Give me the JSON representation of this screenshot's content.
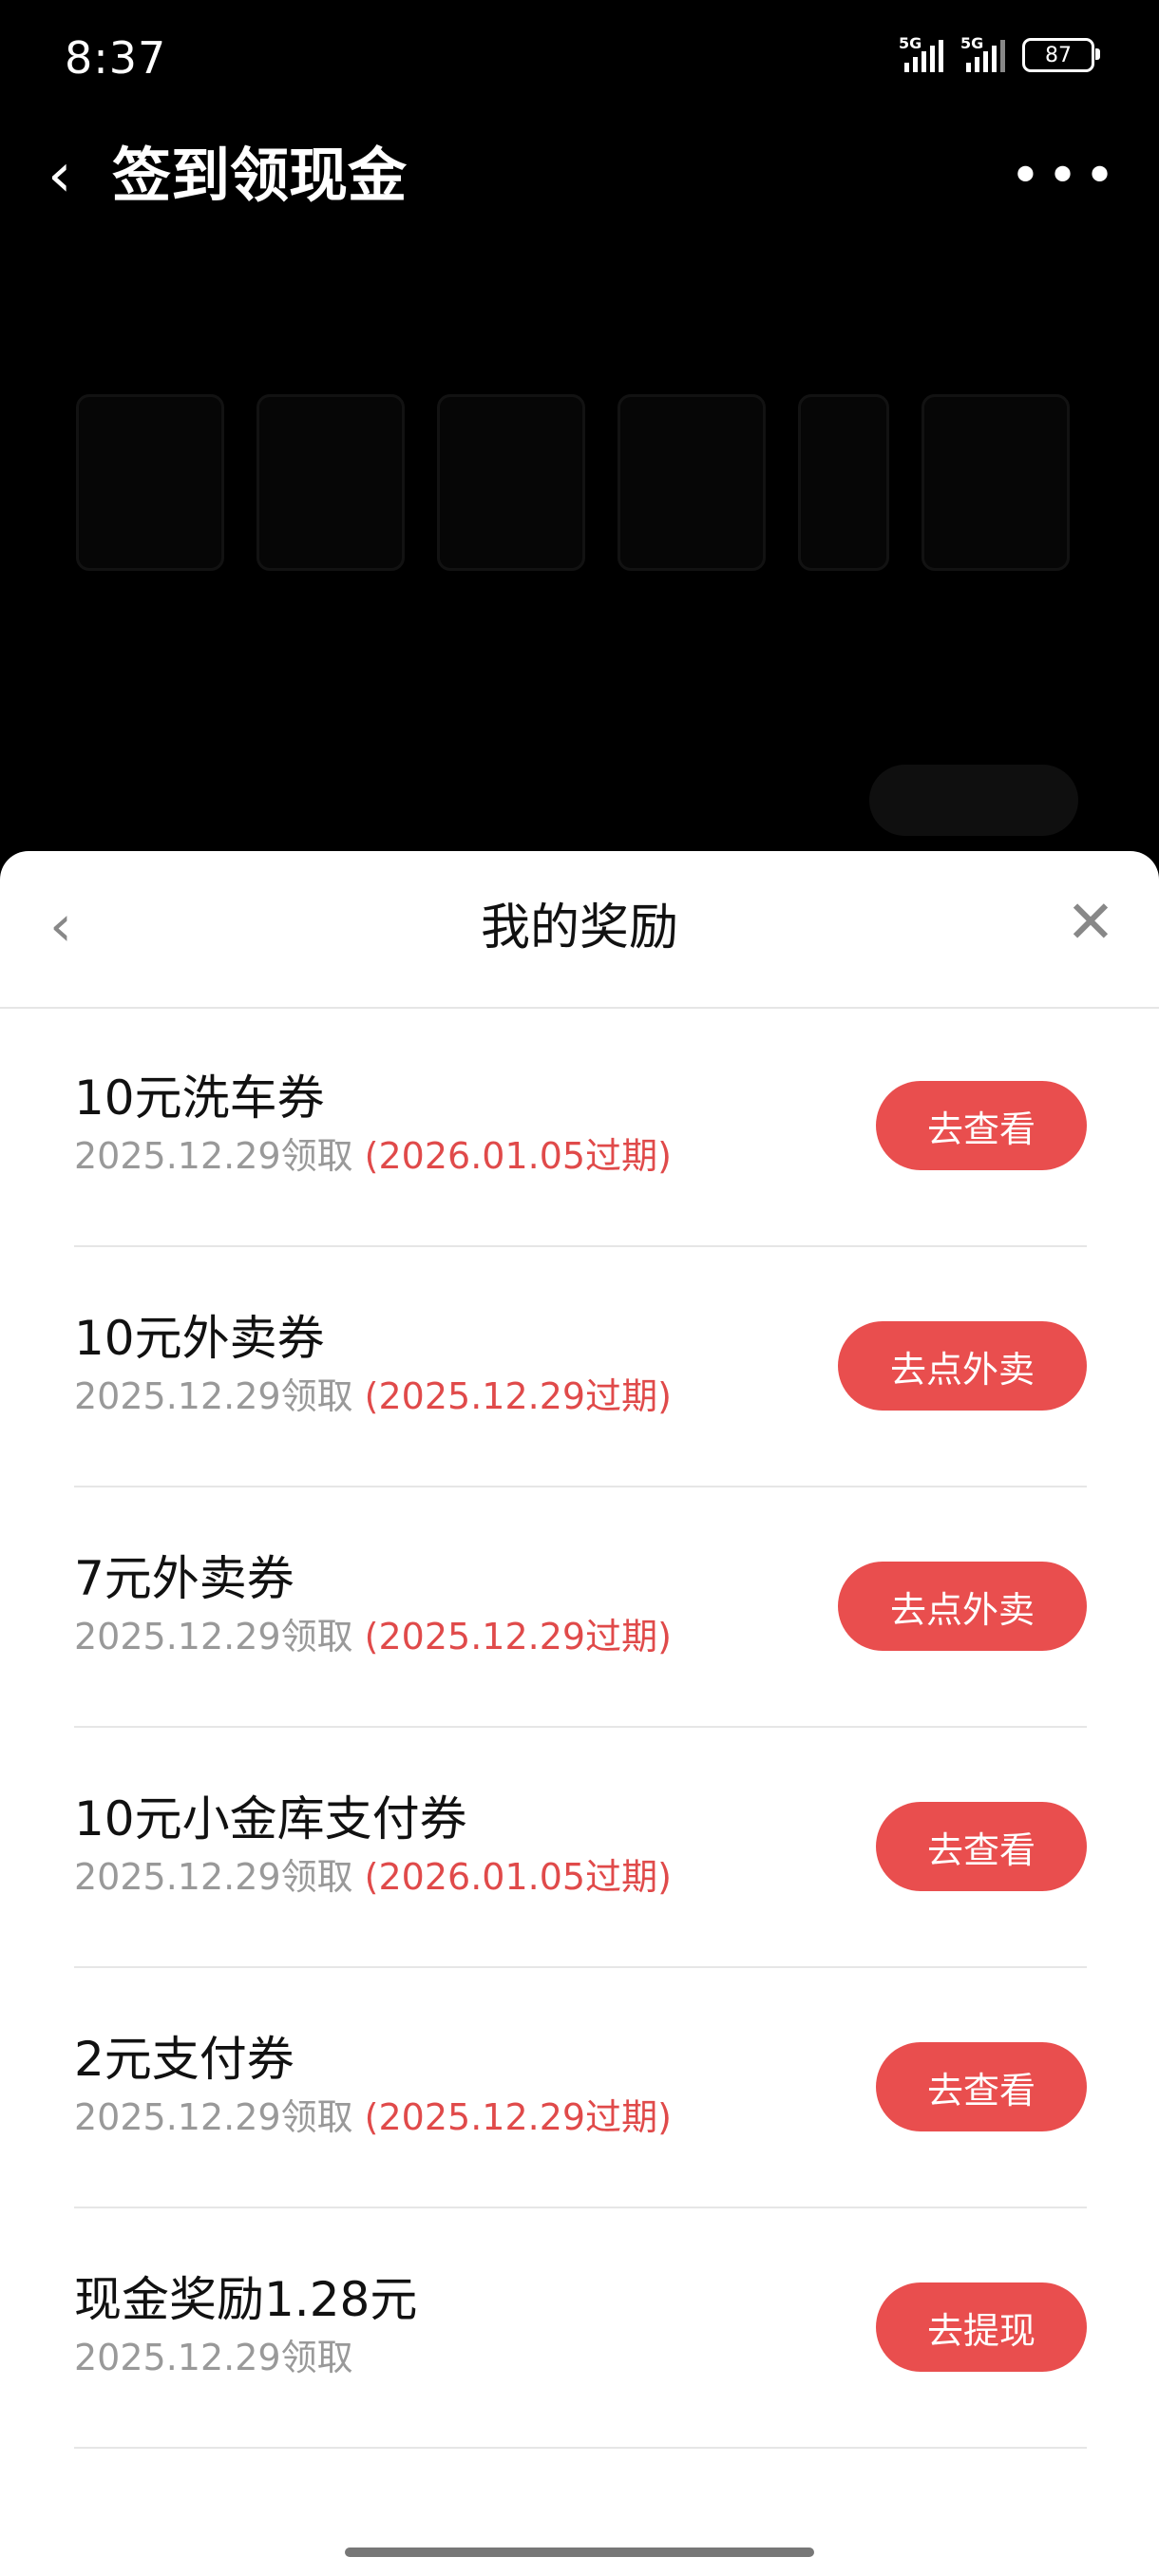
{
  "status": {
    "time": "8:37",
    "battery": "87",
    "sig1": "5G",
    "sig2": "5G"
  },
  "header": {
    "title": "签到领现金"
  },
  "sheet": {
    "title": "我的奖励",
    "items": [
      {
        "name": "10元洗车券",
        "received": "2025.12.29领取",
        "expire": "(2026.01.05过期)",
        "button": "去查看"
      },
      {
        "name": "10元外卖券",
        "received": "2025.12.29领取",
        "expire": "(2025.12.29过期)",
        "button": "去点外卖"
      },
      {
        "name": "7元外卖券",
        "received": "2025.12.29领取",
        "expire": "(2025.12.29过期)",
        "button": "去点外卖"
      },
      {
        "name": "10元小金库支付券",
        "received": "2025.12.29领取",
        "expire": "(2026.01.05过期)",
        "button": "去查看"
      },
      {
        "name": "2元支付券",
        "received": "2025.12.29领取",
        "expire": "(2025.12.29过期)",
        "button": "去查看"
      },
      {
        "name": "现金奖励1.28元",
        "received": "2025.12.29领取",
        "expire": "",
        "button": "去提现"
      }
    ]
  },
  "colors": {
    "accent": "#e94e4e",
    "expire": "#e04a4a"
  }
}
